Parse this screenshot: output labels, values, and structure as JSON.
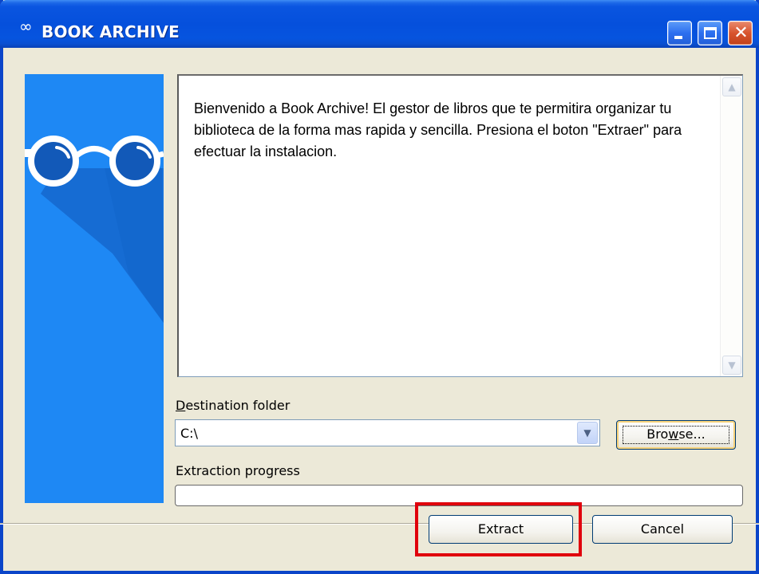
{
  "window": {
    "title": "BOOK ARCHIVE",
    "title_icon": "∞",
    "controls": {
      "minimize": "minimize",
      "maximize": "maximize",
      "close": "close"
    }
  },
  "banner": {
    "icon": "glasses-icon",
    "color": "#1e88f4"
  },
  "description": {
    "text": "Bienvenido a Book Archive! El gestor de libros que te permitira organizar tu biblioteca de la forma mas rapida y sencilla. Presiona el boton \"Extraer\" para efectuar la instalacion."
  },
  "destination": {
    "label_prefix": "",
    "label_accel": "D",
    "label_rest": "estination folder",
    "value": "C:\\"
  },
  "browse_button": {
    "label_prefix": "Bro",
    "label_accel": "w",
    "label_rest": "se..."
  },
  "progress": {
    "label": "Extraction progress",
    "value": 0
  },
  "buttons": {
    "extract": "Extract",
    "cancel": "Cancel"
  },
  "colors": {
    "titlebar": "#0550dc",
    "banner": "#1e88f4",
    "highlight": "#e0000c"
  }
}
